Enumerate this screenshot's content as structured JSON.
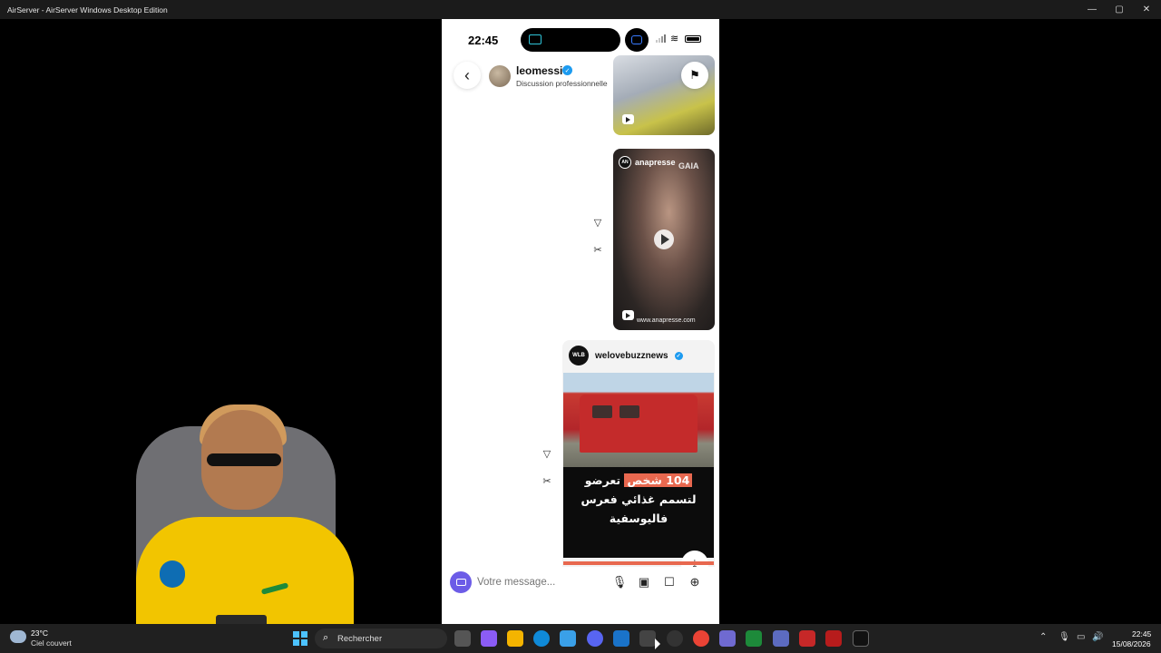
{
  "window": {
    "title": "AirServer - AirServer Windows Desktop Edition",
    "controls": {
      "minimize": "—",
      "maximize": "▢",
      "close": "✕"
    }
  },
  "phone": {
    "status": {
      "time": "22:45"
    },
    "header": {
      "username": "leomessi",
      "subtitle": "Discussion professionnelle",
      "back_icon": "chevron-left-icon",
      "flag_icon": "flag-icon"
    },
    "messages": [
      {
        "type": "reel",
        "account": "",
        "media": "crowd-performer"
      },
      {
        "type": "reel",
        "account": "anapresse",
        "watermark": "GAIA",
        "url": "www.anapresse.com"
      },
      {
        "type": "post",
        "account": "welovebuzznews",
        "logo": "WLB",
        "caption_line1_highlight": "104 شخص",
        "caption_line1_rest": " تعرضو",
        "caption_line2": "لتسمم غذائي فعرس",
        "caption_line3": "فاليوسفية"
      }
    ],
    "composer": {
      "placeholder": "Votre message..."
    }
  },
  "taskbar": {
    "weather_temp": "23°C",
    "weather_desc": "Ciel couvert",
    "search_label": "Rechercher",
    "clock_time": "22:45",
    "clock_date": "15/08/2026"
  },
  "colors": {
    "accent": "#6c5ce7",
    "verified": "#1d9bf0",
    "highlight": "#e8684f",
    "taskbar": "#202020"
  }
}
